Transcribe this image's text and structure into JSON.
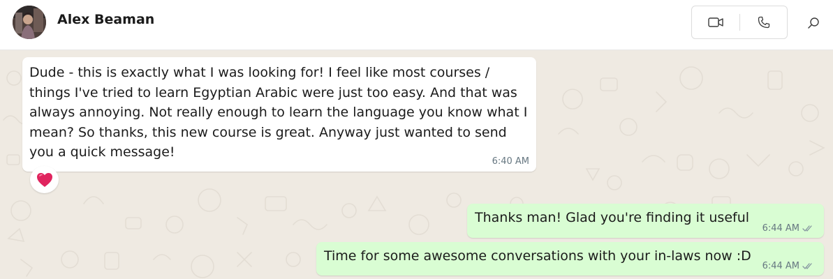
{
  "header": {
    "contact_name": "Alex Beaman",
    "avatar_icon": "user-avatar",
    "video_call_icon": "video-camera-icon",
    "voice_call_icon": "phone-icon",
    "search_icon": "search-icon"
  },
  "colors": {
    "chat_background": "#efeae2",
    "incoming_bubble": "#ffffff",
    "outgoing_bubble": "#d9fdd3",
    "timestamp": "#667781",
    "reaction_heart": "#e0245e"
  },
  "messages": [
    {
      "direction": "incoming",
      "text": "Dude - this is exactly what I was looking for! I feel like most courses / things I've tried to learn Egyptian Arabic were just too easy. And that was always annoying. Not really enough to learn the language you know what I mean? So thanks, this new course is great. Anyway just wanted to send you a quick message!",
      "time": "6:40 AM",
      "reaction_icon": "red-heart-icon"
    },
    {
      "direction": "outgoing",
      "text": "Thanks man! Glad you're finding it useful",
      "time": "6:44 AM",
      "status_icon": "double-check-icon"
    },
    {
      "direction": "outgoing",
      "text": "Time for some awesome conversations with your in-laws now :D",
      "time": "6:44 AM",
      "status_icon": "double-check-icon"
    }
  ]
}
